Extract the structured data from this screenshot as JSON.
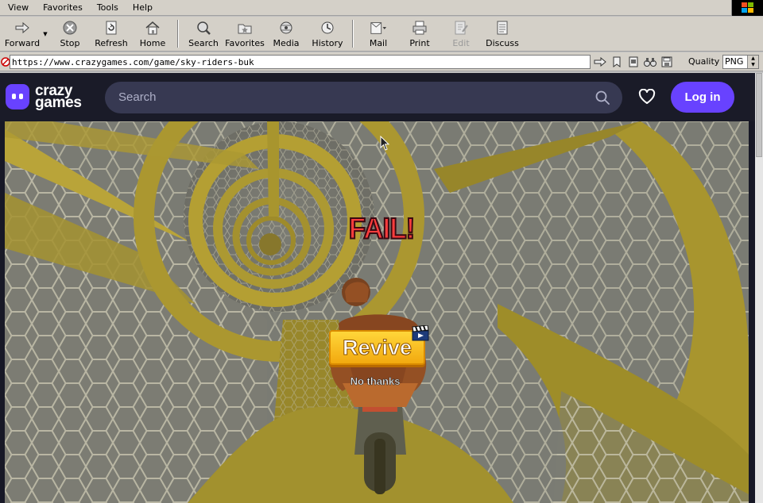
{
  "browser": {
    "menu": [
      {
        "label": "View"
      },
      {
        "label": "Favorites"
      },
      {
        "label": "Tools"
      },
      {
        "label": "Help"
      }
    ],
    "toolbar": {
      "forward": "Forward",
      "stop": "Stop",
      "refresh": "Refresh",
      "home": "Home",
      "search": "Search",
      "favorites": "Favorites",
      "media": "Media",
      "history": "History",
      "mail": "Mail",
      "print": "Print",
      "edit": "Edit",
      "discuss": "Discuss"
    },
    "address": {
      "url": "https://www.crazygames.com/game/sky-riders-buk",
      "quality_label": "Quality",
      "quality_value": "PNG"
    }
  },
  "site": {
    "logo_line1": "crazy",
    "logo_line2": "games",
    "search_placeholder": "Search",
    "login_label": "Log in",
    "brand_color": "#6842ff",
    "header_bg": "#1a1b28"
  },
  "game": {
    "status_text": "FAIL!",
    "revive_label": "Revive",
    "no_thanks_label": "No thanks"
  }
}
